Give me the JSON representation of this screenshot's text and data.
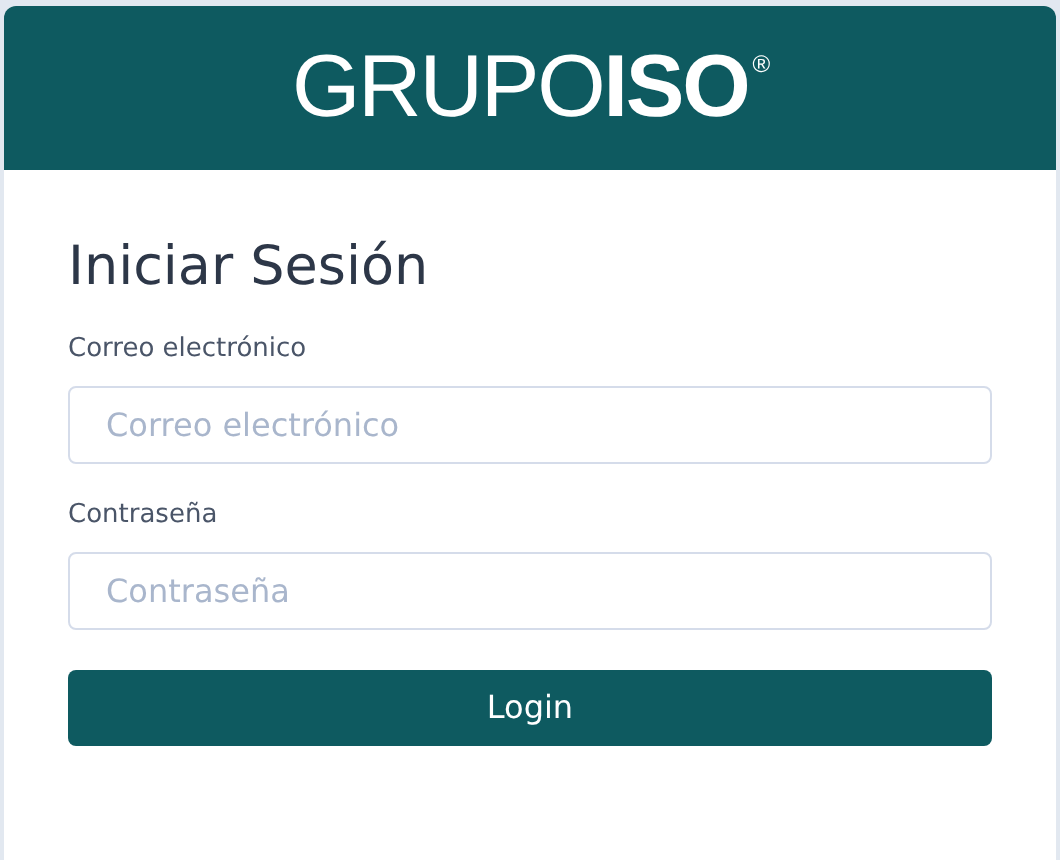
{
  "header": {
    "logo": "GRUPO**ISO**$^{®}$"
  },
  "form": {
    "title": "Iniciar Sesión",
    "fields": [
      {
        "label": "Correo electrónico",
        "placeholder": "Correo electrónico"
      },
      {
        "label": "Contraseña",
        "placeholder": "Contraseña"
      }
    ],
    "submit": "Login"
  }
}
